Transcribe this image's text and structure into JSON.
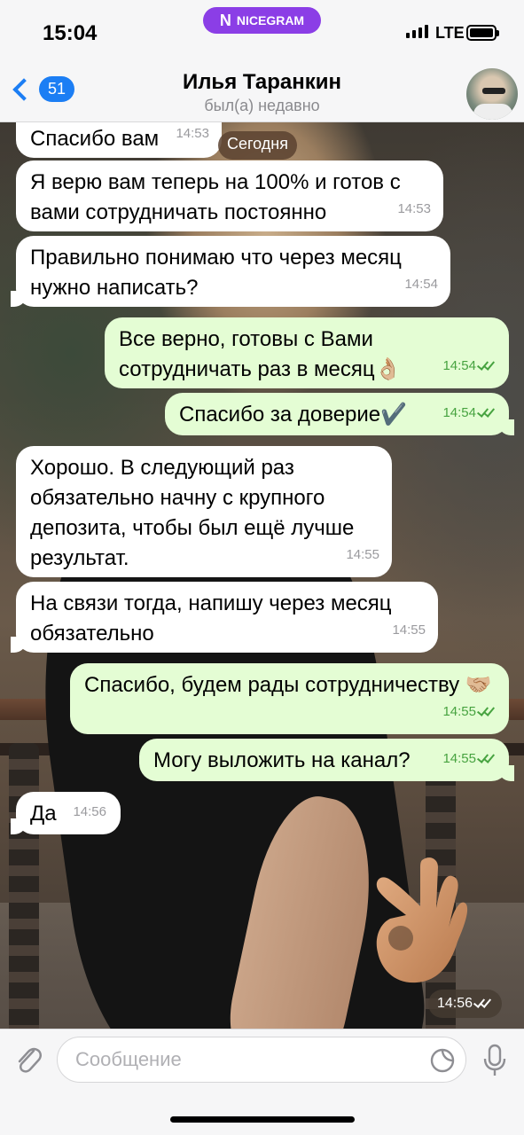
{
  "status_bar": {
    "time": "15:04",
    "app_badge": "NICEGRAM",
    "network": "LTE"
  },
  "header": {
    "back_count": "51",
    "contact_name": "Илья Таранкин",
    "contact_status": "был(а) недавно"
  },
  "date_pill": "Сегодня",
  "messages": [
    {
      "dir": "in",
      "text": "Спасибо вам",
      "time": "14:53"
    },
    {
      "dir": "in",
      "text": "Я верю вам теперь на 100% и готов с вами сотрудничать постоянно",
      "time": "14:53"
    },
    {
      "dir": "in",
      "text": "Правильно понимаю что через месяц нужно написать?",
      "time": "14:54"
    },
    {
      "dir": "out",
      "text": "Все верно, готовы с Вами сотрудничать раз в месяц👌🏼",
      "time": "14:54"
    },
    {
      "dir": "out",
      "text": "Спасибо за доверие✔️",
      "time": "14:54"
    },
    {
      "dir": "in",
      "text": "Хорошо. В следующий раз обязательно начну с крупного депозита, чтобы был ещё лучше результат.",
      "time": "14:55"
    },
    {
      "dir": "in",
      "text": "На связи тогда, напишу через месяц обязательно",
      "time": "14:55"
    },
    {
      "dir": "out",
      "text": "Спасибо, будем рады сотрудничеству 🤝🏼",
      "time": "14:55"
    },
    {
      "dir": "out",
      "text": "Могу выложить на канал?",
      "time": "14:55"
    },
    {
      "dir": "in",
      "text": "Да",
      "time": "14:56"
    },
    {
      "dir": "out",
      "text": "👌🏼",
      "time": "14:56",
      "kind": "big-emoji"
    }
  ],
  "input": {
    "placeholder": "Сообщение"
  },
  "icons": {
    "back": "chevron-left-icon",
    "attach": "paperclip-icon",
    "sticker": "sticker-icon",
    "mic": "microphone-icon"
  },
  "colors": {
    "accent": "#1c7ef4",
    "outgoing_bubble": "#e4fdd4",
    "incoming_bubble": "#ffffff",
    "nicegram_badge": "#8b3ee6",
    "read_ticks": "#47a340"
  }
}
